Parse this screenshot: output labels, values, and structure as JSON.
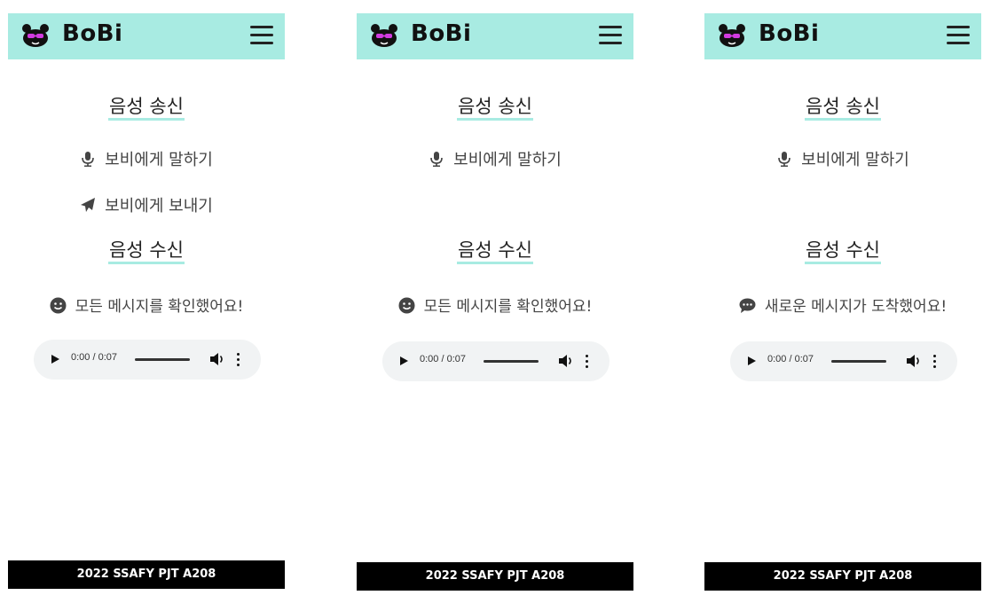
{
  "brand": "BoBi",
  "colors": {
    "header_bg": "#a8ebe2",
    "underline": "#a8ebe2",
    "footer_bg": "#000000"
  },
  "icons": {
    "logo": "bobi-face-icon",
    "menu": "hamburger-icon",
    "mic": "microphone-icon",
    "send": "paper-plane-icon",
    "smile": "smile-icon",
    "chat": "chat-bubble-icon"
  },
  "screens": [
    {
      "send_title": "음성 송신",
      "talk_label": "보비에게 말하기",
      "send_label": "보비에게 보내기",
      "receive_title": "음성 수신",
      "status_text": "모든 메시지를 확인했어요!",
      "player": {
        "time": "0:00 / 0:07"
      },
      "footer": "2022 SSAFY PJT A208"
    },
    {
      "send_title": "음성 송신",
      "talk_label": "보비에게 말하기",
      "receive_title": "음성 수신",
      "status_text": "모든 메시지를 확인했어요!",
      "player": {
        "time": "0:00 / 0:07"
      },
      "footer": "2022 SSAFY PJT A208"
    },
    {
      "send_title": "음성 송신",
      "talk_label": "보비에게 말하기",
      "receive_title": "음성 수신",
      "status_text": "새로운 메시지가 도착했어요!",
      "player": {
        "time": "0:00 / 0:07"
      },
      "footer": "2022 SSAFY PJT A208"
    }
  ]
}
